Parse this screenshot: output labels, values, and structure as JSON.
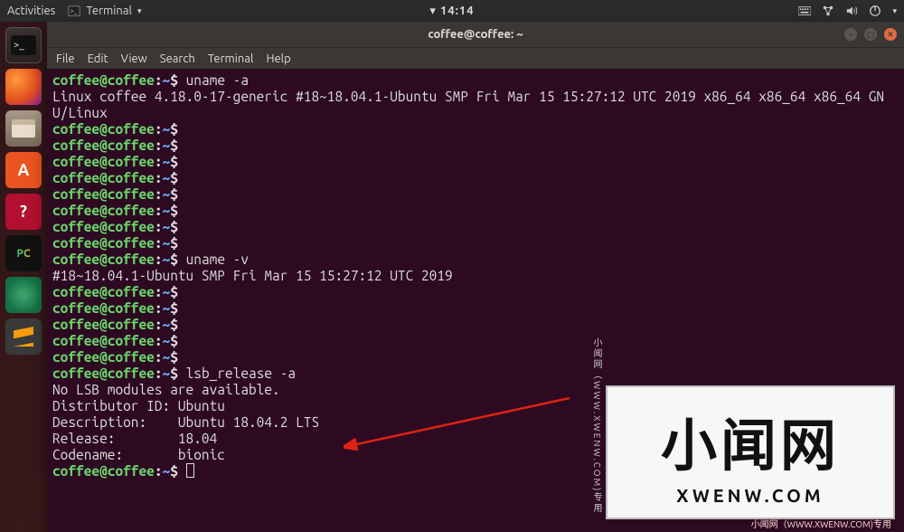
{
  "topbar": {
    "activities": "Activities",
    "app_icon": "terminal-icon",
    "app_name": "Terminal",
    "clock": "14:14"
  },
  "launcher": {
    "items": [
      {
        "name": "terminal",
        "label": ">_"
      },
      {
        "name": "firefox",
        "label": ""
      },
      {
        "name": "files",
        "label": ""
      },
      {
        "name": "software",
        "label": "A"
      },
      {
        "name": "help",
        "label": "?"
      },
      {
        "name": "pycharm",
        "label": "PC"
      },
      {
        "name": "atom",
        "label": ""
      },
      {
        "name": "sublime",
        "label": ""
      }
    ]
  },
  "window": {
    "title": "coffee@coffee: ~",
    "menu": [
      "File",
      "Edit",
      "View",
      "Search",
      "Terminal",
      "Help"
    ]
  },
  "term": {
    "user": "coffee@coffee",
    "colon": ":",
    "path": "~",
    "sigil": "$",
    "cmd_uname_a": "uname -a",
    "out_uname_a": "Linux coffee 4.18.0-17-generic #18~18.04.1-Ubuntu SMP Fri Mar 15 15:27:12 UTC 2019 x86_64 x86_64 x86_64 GNU/Linux",
    "cmd_uname_v": "uname -v",
    "out_uname_v": "#18~18.04.1-Ubuntu SMP Fri Mar 15 15:27:12 UTC 2019",
    "cmd_lsb": "lsb_release -a",
    "lsb_lines": [
      "No LSB modules are available.",
      "Distributor ID: Ubuntu",
      "Description:    Ubuntu 18.04.2 LTS",
      "Release:        18.04",
      "Codename:       bionic"
    ]
  },
  "watermark": {
    "big": "小闻网",
    "small": "XWENW.COM",
    "side": "小闻网（WWW.XWENW.COM)专用",
    "foot": "小闻网（WWW.XWENW.COM)专用"
  }
}
